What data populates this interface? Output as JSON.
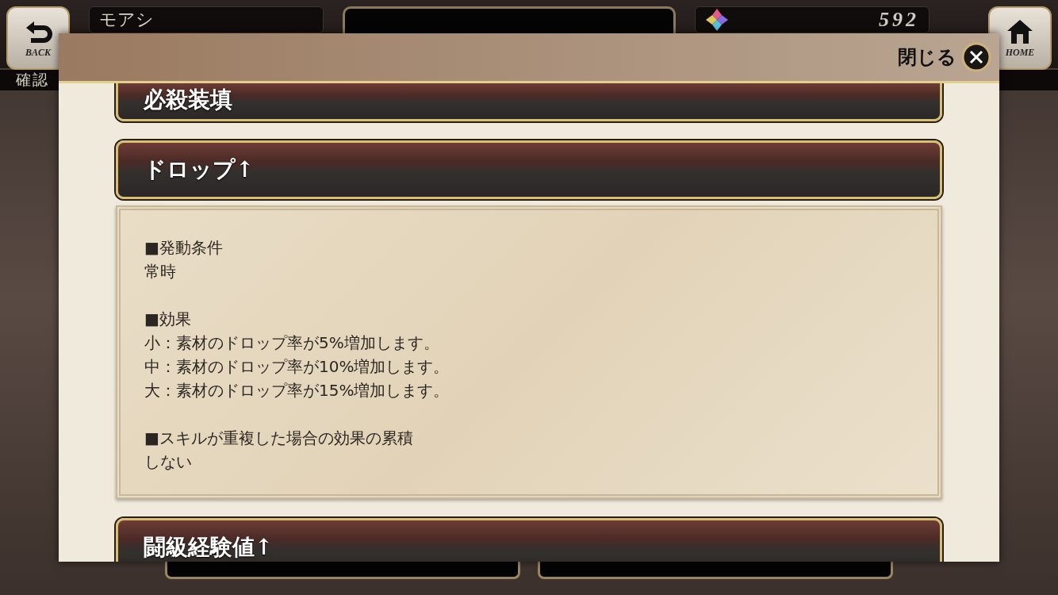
{
  "top_bar": {
    "back_button": "BACK",
    "player_name": "モアシ",
    "currency": "592",
    "home_button": "HOME",
    "sub_label": "確認"
  },
  "dialog": {
    "close_label": "閉じる",
    "sections": [
      {
        "title": "必殺装填"
      },
      {
        "title": "ドロップ↑",
        "blocks": [
          {
            "heading": "■発動条件",
            "lines": [
              "常時"
            ]
          },
          {
            "heading": "■効果",
            "lines": [
              "小：素材のドロップ率が5%増加します。",
              "中：素材のドロップ率が10%増加します。",
              "大：素材のドロップ率が15%増加します。"
            ]
          },
          {
            "heading": "■スキルが重複した場合の効果の累積",
            "lines": [
              "しない"
            ]
          }
        ]
      },
      {
        "title": "闘級経験値↑"
      }
    ]
  }
}
